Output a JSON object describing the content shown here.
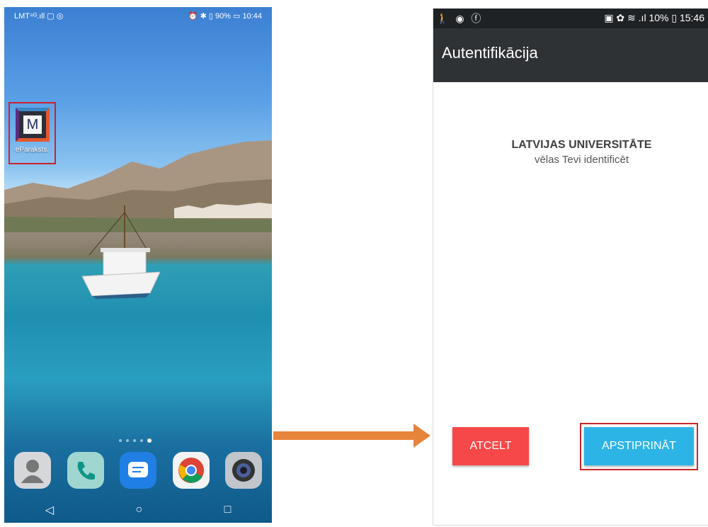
{
  "left_phone": {
    "status_left": "LMT⁴ᴳ.ıll ▢ ◎",
    "status_right": "⏰ ✱ ▯ 90% ▭ 10:44",
    "app_icon_letter": "M",
    "app_label": "eParaksts.",
    "nav_back": "◁",
    "nav_home": "○",
    "nav_recent": "□"
  },
  "right_phone": {
    "status_icons_left": "🚶 ◉ ⓕ",
    "status_right": "▣ ✿ ≋ .ıl 10% ▯ 15:46",
    "title": "Autentifikācija",
    "org_name": "LATVIJAS UNIVERSITĀTE",
    "prompt": "vēlas Tevi identificēt",
    "cancel_label": "ATCELT",
    "confirm_label": "APSTIPRINĀT"
  },
  "colors": {
    "arrow": "#e6843c",
    "cancel": "#f64848",
    "confirm": "#2db4e6",
    "highlight": "#d0202e",
    "appbar": "#2f3235"
  }
}
